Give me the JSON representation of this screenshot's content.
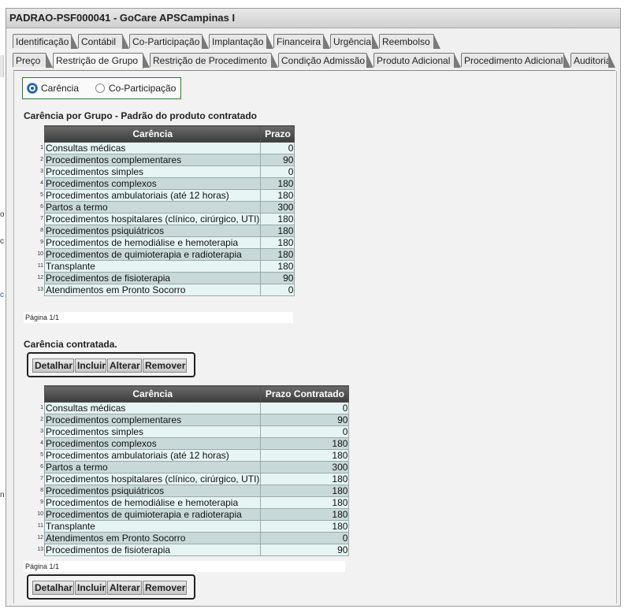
{
  "window": {
    "title": "PADRAO-PSF000041 - GoCare APSCampinas I"
  },
  "edge_marks": [
    "o",
    "c",
    "c",
    "n"
  ],
  "tabs_row1": [
    "Identificação",
    "Contábil",
    "Co-Participação",
    "Implantação",
    "Financeira",
    "Urgência",
    "Reembolso"
  ],
  "tabs_row2": [
    "Preço",
    "Restrição de Grupo",
    "Restrição de Procedimento",
    "Condição Admissão",
    "Produto Adicional",
    "Procedimento Adicional",
    "Auditoria"
  ],
  "active_tab": "Restrição de Grupo",
  "radio": {
    "option1": "Carência",
    "option2": "Co-Participação",
    "selected": "Carência"
  },
  "table1": {
    "title": "Carência por Grupo - Padrão do produto contratado",
    "headers": [
      "Carência",
      "Prazo"
    ],
    "rows": [
      [
        "1",
        "Consultas médicas",
        "0"
      ],
      [
        "2",
        "Procedimentos complementares",
        "90"
      ],
      [
        "3",
        "Procedimentos simples",
        "0"
      ],
      [
        "4",
        "Procedimentos complexos",
        "180"
      ],
      [
        "5",
        "Procedimentos ambulatoriais (até 12 horas)",
        "180"
      ],
      [
        "6",
        "Partos a termo",
        "300"
      ],
      [
        "7",
        "Procedimentos hospitalares (clínico, cirúrgico, UTI)",
        "180"
      ],
      [
        "8",
        "Procedimentos psiquiátricos",
        "180"
      ],
      [
        "9",
        "Procedimentos de hemodiálise e hemoterapia",
        "180"
      ],
      [
        "10",
        "Procedimentos de quimioterapia e radioterapia",
        "180"
      ],
      [
        "11",
        "Transplante",
        "180"
      ],
      [
        "12",
        "Procedimentos de fisioterapia",
        "90"
      ],
      [
        "13",
        "Atendimentos em Pronto Socorro",
        "0"
      ]
    ],
    "pager": "Página 1/1"
  },
  "table2": {
    "title": "Carência contratada.",
    "headers": [
      "Carência",
      "Prazo Contratado"
    ],
    "rows": [
      [
        "1",
        "Consultas médicas",
        "0"
      ],
      [
        "2",
        "Procedimentos complementares",
        "90"
      ],
      [
        "3",
        "Procedimentos simples",
        "0"
      ],
      [
        "4",
        "Procedimentos complexos",
        "180"
      ],
      [
        "5",
        "Procedimentos ambulatoriais (até 12 horas)",
        "180"
      ],
      [
        "6",
        "Partos a termo",
        "300"
      ],
      [
        "7",
        "Procedimentos hospitalares (clínico, cirúrgico, UTI)",
        "180"
      ],
      [
        "8",
        "Procedimentos psiquiátricos",
        "180"
      ],
      [
        "9",
        "Procedimentos de hemodiálise e hemoterapia",
        "180"
      ],
      [
        "10",
        "Procedimentos de quimioterapia e radioterapia",
        "180"
      ],
      [
        "11",
        "Transplante",
        "180"
      ],
      [
        "12",
        "Atendimentos em Pronto Socorro",
        "0"
      ],
      [
        "13",
        "Procedimentos de fisioterapia",
        "90"
      ]
    ],
    "pager": "Página 1/1"
  },
  "buttons": {
    "detail": "Detalhar",
    "add": "Incluir",
    "edit": "Alterar",
    "remove": "Remover"
  },
  "colors": {
    "header_bg": "#3c3c3c",
    "row_light": "#e6f4f4",
    "row_dark": "#c9d9d9",
    "radio_border": "#2a7a2a"
  }
}
